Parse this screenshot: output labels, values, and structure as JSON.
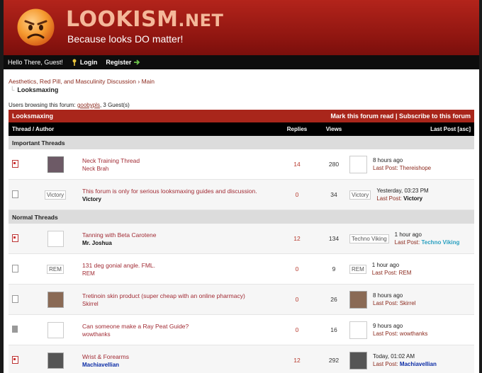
{
  "header": {
    "site_name": "LOOKISM",
    "site_tld": ".NET",
    "tagline": "Because looks DO matter!"
  },
  "userbar": {
    "greeting": "Hello There, Guest!",
    "login": "Login",
    "register": "Register"
  },
  "breadcrumb": {
    "forum": "Aesthetics, Red Pill, and Masculinity Discussion",
    "sep": "›",
    "main": "Main",
    "current": "Looksmaxing"
  },
  "browsing": {
    "prefix": "Users browsing this forum:",
    "user": "goobypls",
    "suffix": ", 3 Guest(s)"
  },
  "forum_header": {
    "title": "Looksmaxing",
    "mark_read": "Mark this forum read",
    "divider": "|",
    "subscribe": "Subscribe to this forum"
  },
  "columns": {
    "thread": "Thread / Author",
    "replies": "Replies",
    "views": "Views",
    "last_post": "Last Post [asc]"
  },
  "sections": {
    "important": "Important Threads",
    "normal": "Normal Threads"
  },
  "last_post_label": "Last Post:",
  "threads": [
    {
      "title": "Neck Training Thread",
      "author": "Neck Brah",
      "replies": "14",
      "views": "280",
      "time": "8 hours ago",
      "last_by": "Thereishope"
    },
    {
      "title": "This forum is only for serious looksmaxing guides and discussion.",
      "author": "Victory",
      "avatar_alt": "Victory",
      "replies": "0",
      "views": "34",
      "time": "Yesterday, 03:23 PM",
      "last_by": "Victory",
      "last_alt": "Victory"
    },
    {
      "title": "Tanning with Beta Carotene",
      "author": "Mr. Joshua",
      "replies": "12",
      "views": "134",
      "time": "1 hour ago",
      "last_by": "Techno Viking",
      "last_alt": "Techno Viking"
    },
    {
      "title": "131 deg gonial angle. FML.",
      "author": "REM",
      "avatar_alt": "REM",
      "replies": "0",
      "views": "9",
      "time": "1 hour ago",
      "last_by": "REM",
      "last_alt": "REM"
    },
    {
      "title": "Tretinoin skin product (super cheap with an online pharmacy)",
      "author": "Skirrel",
      "replies": "0",
      "views": "26",
      "time": "8 hours ago",
      "last_by": "Skirrel"
    },
    {
      "title": "Can someone make a Ray Peat Guide?",
      "author": "wowthanks",
      "replies": "0",
      "views": "16",
      "time": "9 hours ago",
      "last_by": "wowthanks"
    },
    {
      "title": "Wrist & Forearms",
      "author": "Machiavellian",
      "replies": "12",
      "views": "292",
      "time": "Today, 01:02 AM",
      "last_by": "Machiavellian"
    }
  ]
}
